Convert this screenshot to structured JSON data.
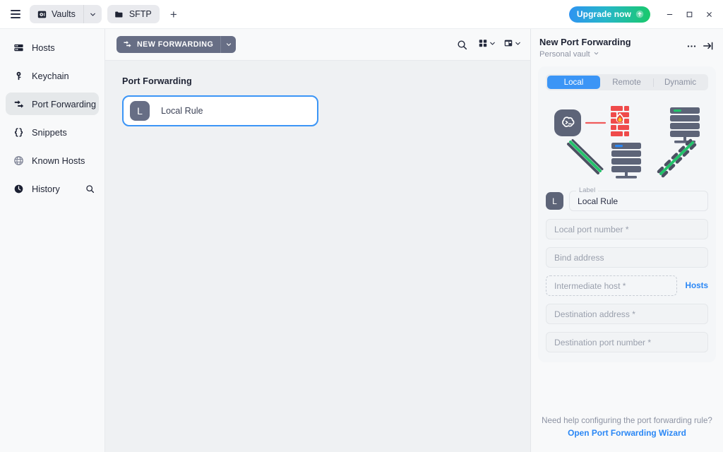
{
  "titlebar": {
    "menu_icon": "hamburger-icon",
    "tabs": [
      {
        "label": "Vaults",
        "icon": "vault-icon",
        "has_caret": true
      },
      {
        "label": "SFTP",
        "icon": "folder-icon",
        "has_caret": false
      }
    ],
    "new_tab_label": "+",
    "upgrade_label": "Upgrade now",
    "upgrade_icon": "arrow-up-circle-icon",
    "window_buttons": [
      "minimize",
      "maximize",
      "close"
    ],
    "accent_gradient_from": "#2f93f2",
    "accent_gradient_to": "#19c96a"
  },
  "sidebar": {
    "items": [
      {
        "label": "Hosts",
        "icon": "server-rack-icon",
        "active": false,
        "trailing": ""
      },
      {
        "label": "Keychain",
        "icon": "key-icon",
        "active": false,
        "trailing": ""
      },
      {
        "label": "Port Forwarding",
        "icon": "port-forwarding-arrows-icon",
        "active": true,
        "trailing": ""
      },
      {
        "label": "Snippets",
        "icon": "curly-braces-icon",
        "active": false,
        "trailing": ""
      },
      {
        "label": "Known Hosts",
        "icon": "globe-icon",
        "active": false,
        "trailing": ""
      },
      {
        "label": "History",
        "icon": "clock-icon",
        "active": false,
        "trailing": "search-icon"
      }
    ]
  },
  "toolbar": {
    "new_forwarding_label": "NEW FORWARDING",
    "new_forwarding_icon": "port-forwarding-arrows-icon",
    "new_forwarding_caret": "chevron-down-icon",
    "search_icon": "search-icon",
    "grid_view_icon": "grid-view-icon",
    "layout_view_icon": "layout-view-icon"
  },
  "main": {
    "section_title": "Port Forwarding",
    "rules": [
      {
        "avatar_letter": "L",
        "name": "Local Rule",
        "selected": true
      }
    ],
    "selection_color": "#3b95f6"
  },
  "panel": {
    "title": "New Port Forwarding",
    "vault_label": "Personal vault",
    "vault_caret": "chevron-down-icon",
    "more_icon": "ellipsis-icon",
    "collapse_icon": "collapse-panel-right-icon",
    "tabs": [
      {
        "label": "Local",
        "active": true
      },
      {
        "label": "Remote",
        "active": false
      },
      {
        "label": "Dynamic",
        "active": false
      }
    ],
    "diagram": {
      "name": "local-port-forwarding-diagram",
      "nodes": [
        "terminal-cloud-icon",
        "firewall-brick-icon",
        "remote-server-icon",
        "intermediate-server-icon"
      ],
      "tunnels": [
        "green-tunnel-left",
        "green-dashed-tunnel-right"
      ],
      "blocked_link_color": "#ef5b5b",
      "tunnel_color": "#2ecc83"
    },
    "fields": [
      {
        "name": "label-field",
        "floating_label": "Label",
        "value": "Local Rule",
        "avatar_letter": "L",
        "style": "outlined-floating"
      },
      {
        "name": "local-port-number-field",
        "placeholder": "Local port number *",
        "value": "",
        "style": "filled"
      },
      {
        "name": "bind-address-field",
        "placeholder": "Bind address",
        "value": "",
        "style": "filled"
      },
      {
        "name": "intermediate-host-field",
        "placeholder": "Intermediate host *",
        "value": "",
        "style": "dashed",
        "trailing_link": "Hosts"
      },
      {
        "name": "destination-address-field",
        "placeholder": "Destination address *",
        "value": "",
        "style": "filled"
      },
      {
        "name": "destination-port-number-field",
        "placeholder": "Destination port number *",
        "value": "",
        "style": "filled"
      }
    ],
    "footer": {
      "question": "Need help configuring the port forwarding rule?",
      "link": "Open Port Forwarding Wizard",
      "link_color": "#2a87f5"
    }
  }
}
